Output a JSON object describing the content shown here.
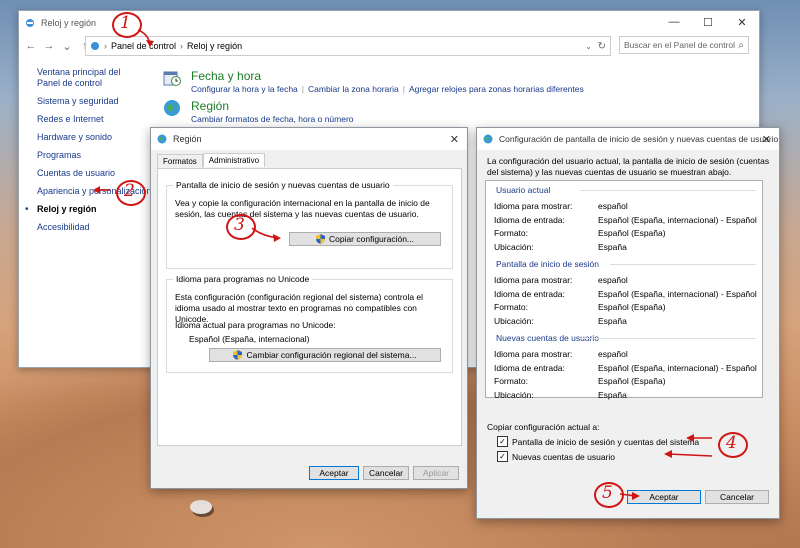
{
  "main_window": {
    "title": "Reloj y región",
    "breadcrumb": [
      "Panel de control",
      "Reloj y región"
    ],
    "search_placeholder": "Buscar en el Panel de control",
    "controls": {
      "minimize": "—",
      "maximize": "☐",
      "close": "✕"
    },
    "nav": {
      "back": "←",
      "forward": "→",
      "dropdown": "⌄",
      "up": "↑"
    },
    "sidebar": [
      "Ventana principal del Panel de control",
      "Sistema y seguridad",
      "Redes e Internet",
      "Hardware y sonido",
      "Programas",
      "Cuentas de usuario",
      "Apariencia y personalización",
      "Reloj y región",
      "Accesibilidad"
    ],
    "categories": [
      {
        "title": "Fecha y hora",
        "links": [
          "Configurar la hora y la fecha",
          "Cambiar la zona horaria",
          "Agregar relojes para zonas horarias diferentes"
        ]
      },
      {
        "title": "Región",
        "links": [
          "Cambiar formatos de fecha, hora o número"
        ]
      }
    ]
  },
  "region_dialog": {
    "title": "Región",
    "tabs": [
      "Formatos",
      "Administrativo"
    ],
    "welcome_group": {
      "label": "Pantalla de inicio de sesión y nuevas cuentas de usuario",
      "text": "Vea y copie la configuración internacional en la pantalla de inicio de sesión, las cuentas del sistema y las nuevas cuentas de usuario.",
      "button": "Copiar configuración..."
    },
    "unicode_group": {
      "label": "Idioma para programas no Unicode",
      "text": "Esta configuración (configuración regional del sistema) controla el idioma usado al mostrar texto en programas no compatibles con Unicode.",
      "current_label": "Idioma actual para programas no Unicode:",
      "current_value": "Español (España, internacional)",
      "button": "Cambiar configuración regional del sistema..."
    },
    "buttons": {
      "accept": "Aceptar",
      "cancel": "Cancelar",
      "apply": "Aplicar"
    }
  },
  "config_dialog": {
    "title": "Configuración de pantalla de inicio de sesión y nuevas cuentas de usuario",
    "description": "La configuración del usuario actual, la pantalla de inicio de sesión (cuentas del sistema) y las nuevas cuentas de usuario se muestran abajo.",
    "sections": [
      {
        "title": "Usuario actual",
        "rows": [
          [
            "Idioma para mostrar:",
            "español"
          ],
          [
            "Idioma de entrada:",
            "Español (España, internacional) - Español"
          ],
          [
            "Formato:",
            "Español (España)"
          ],
          [
            "Ubicación:",
            "España"
          ]
        ]
      },
      {
        "title": "Pantalla de inicio de sesión",
        "rows": [
          [
            "Idioma para mostrar:",
            "español"
          ],
          [
            "Idioma de entrada:",
            "Español (España, internacional) - Español"
          ],
          [
            "Formato:",
            "Español (España)"
          ],
          [
            "Ubicación:",
            "España"
          ]
        ]
      },
      {
        "title": "Nuevas cuentas de usuario",
        "rows": [
          [
            "Idioma para mostrar:",
            "español"
          ],
          [
            "Idioma de entrada:",
            "Español (España, internacional) - Español"
          ],
          [
            "Formato:",
            "Español (España)"
          ],
          [
            "Ubicación:",
            "España"
          ]
        ]
      }
    ],
    "copy_label": "Copiar configuración actual a:",
    "checkboxes": [
      {
        "label": "Pantalla de inicio de sesión y cuentas del sistema",
        "checked": true
      },
      {
        "label": "Nuevas cuentas de usuario",
        "checked": true
      }
    ],
    "buttons": {
      "accept": "Aceptar",
      "cancel": "Cancelar"
    }
  },
  "annotations": [
    "1",
    "2",
    "3",
    "4",
    "5"
  ],
  "colors": {
    "link": "#1a3a8a",
    "category": "#1e7b28",
    "annotation": "#d01515",
    "accent": "#0078d7"
  }
}
